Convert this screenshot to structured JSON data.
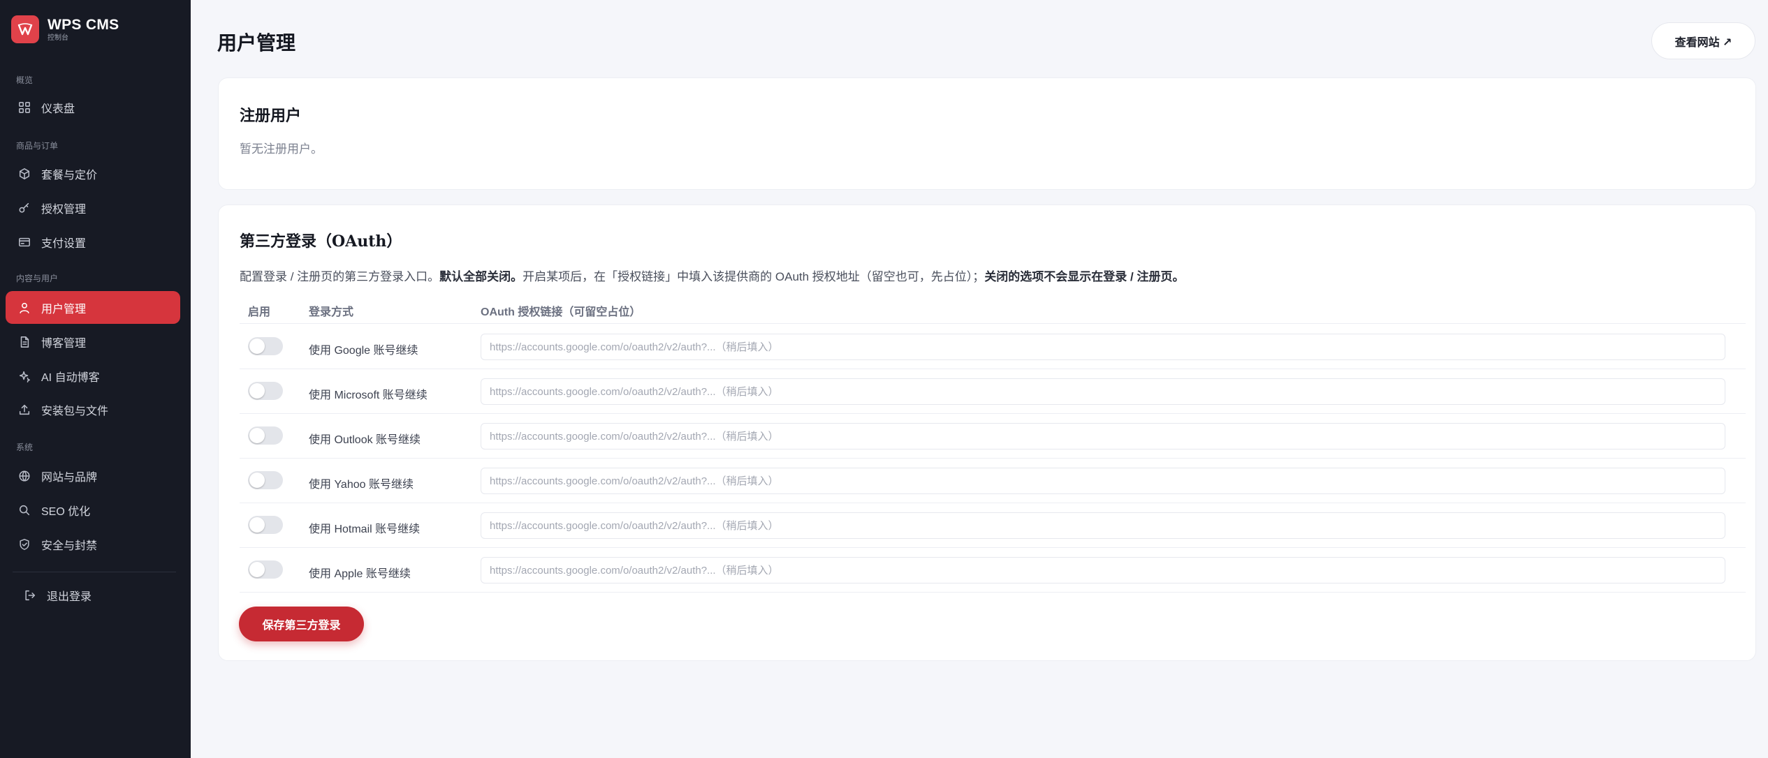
{
  "brand": {
    "title": "WPS CMS",
    "subtitle": "控制台"
  },
  "sidebar": {
    "groups": [
      "概览",
      "商品与订单",
      "内容与用户",
      "系统"
    ],
    "items": [
      {
        "label": "仪表盘",
        "icon": "grid-icon"
      },
      {
        "label": "套餐与定价",
        "icon": "box-icon"
      },
      {
        "label": "授权管理",
        "icon": "key-icon"
      },
      {
        "label": "支付设置",
        "icon": "card-icon"
      },
      {
        "label": "用户管理",
        "icon": "user-icon",
        "active": true
      },
      {
        "label": "博客管理",
        "icon": "file-icon"
      },
      {
        "label": "AI 自动博客",
        "icon": "sparkle-icon"
      },
      {
        "label": "安装包与文件",
        "icon": "upload-icon"
      },
      {
        "label": "网站与品牌",
        "icon": "globe-icon"
      },
      {
        "label": "SEO 优化",
        "icon": "search-icon"
      },
      {
        "label": "安全与封禁",
        "icon": "shield-icon"
      }
    ],
    "logout": "退出登录"
  },
  "header": {
    "title": "用户管理",
    "visit_site": "查看网站 ↗"
  },
  "registered": {
    "title": "注册用户",
    "empty": "暂无注册用户。"
  },
  "oauth": {
    "title": "第三方登录（OAuth）",
    "desc_1": "配置登录 / 注册页的第三方登录入口。",
    "desc_bold_1": "默认全部关闭。",
    "desc_2": "开启某项后，在「授权链接」中填入该提供商的 OAuth 授权地址（留空也可，先占位）；",
    "desc_bold_2": "关闭的选项不会显示在登录 / 注册页。",
    "columns": [
      "启用",
      "登录方式",
      "OAuth 授权链接（可留空占位）"
    ],
    "providers": [
      {
        "label": "使用 Google 账号继续",
        "enabled": false,
        "url": "",
        "placeholder": "https://accounts.google.com/o/oauth2/v2/auth?...（稍后填入）"
      },
      {
        "label": "使用 Microsoft 账号继续",
        "enabled": false,
        "url": "",
        "placeholder": "https://accounts.google.com/o/oauth2/v2/auth?...（稍后填入）"
      },
      {
        "label": "使用 Outlook 账号继续",
        "enabled": false,
        "url": "",
        "placeholder": "https://accounts.google.com/o/oauth2/v2/auth?...（稍后填入）"
      },
      {
        "label": "使用 Yahoo 账号继续",
        "enabled": false,
        "url": "",
        "placeholder": "https://accounts.google.com/o/oauth2/v2/auth?...（稍后填入）"
      },
      {
        "label": "使用 Hotmail 账号继续",
        "enabled": false,
        "url": "",
        "placeholder": "https://accounts.google.com/o/oauth2/v2/auth?...（稍后填入）"
      },
      {
        "label": "使用 Apple 账号继续",
        "enabled": false,
        "url": "",
        "placeholder": "https://accounts.google.com/o/oauth2/v2/auth?...（稍后填入）"
      }
    ],
    "save_label": "保存第三方登录"
  },
  "colors": {
    "accent": "#d6353d",
    "sidebar_bg": "#171a24",
    "page_bg": "#f5f6fa",
    "save_button": "#c62a33"
  }
}
